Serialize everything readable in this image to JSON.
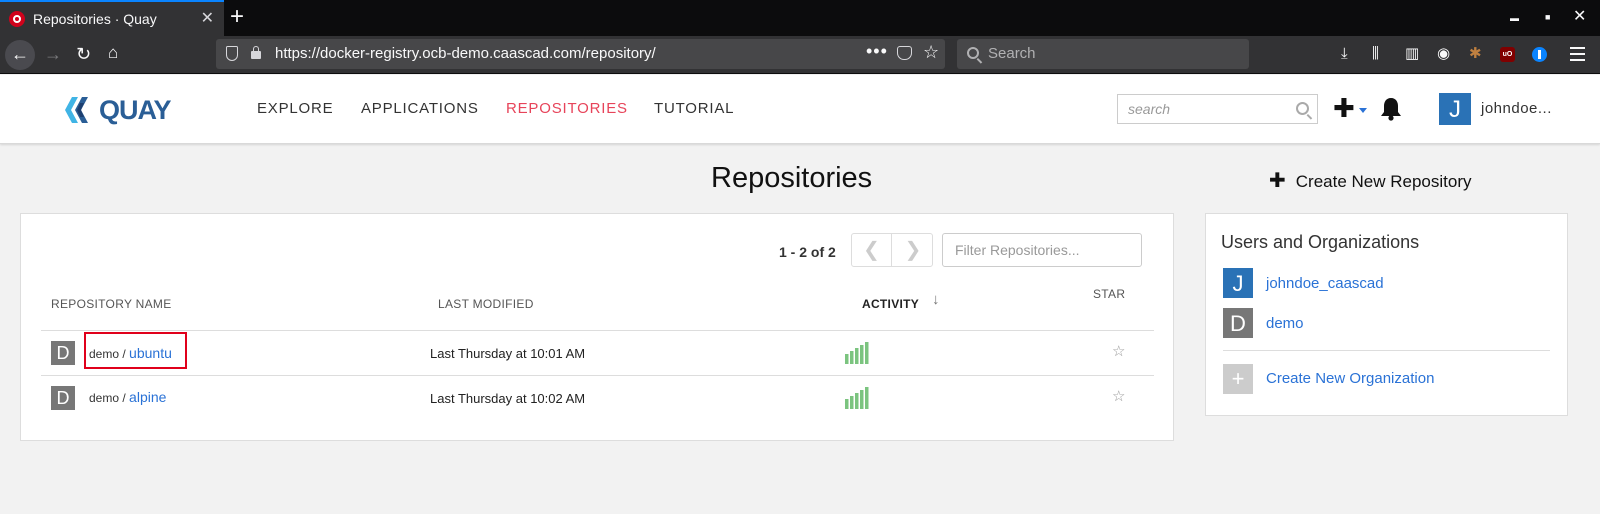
{
  "browser": {
    "tab_title": "Repositories · Quay",
    "tab_close": "✕",
    "new_tab": "+",
    "url": "https://docker-registry.ocb-demo.caascad.com/repository/",
    "search_placeholder": "Search",
    "url_more": "•••",
    "url_star": "☆",
    "win_min": "▬",
    "win_max": "■",
    "win_close": "✕"
  },
  "header": {
    "logo": "QUAY",
    "nav": [
      "EXPLORE",
      "APPLICATIONS",
      "REPOSITORIES",
      "TUTORIAL"
    ],
    "active_nav": "REPOSITORIES",
    "search_placeholder": "search",
    "avatar_letter": "J",
    "username": "johndoe...",
    "plus_label": "✚"
  },
  "page": {
    "title": "Repositories",
    "create_repo": "Create New Repository",
    "create_plus": "✚"
  },
  "list": {
    "pager_count": "1 - 2 of 2",
    "prev": "❮",
    "next": "❯",
    "filter_placeholder": "Filter Repositories...",
    "columns": [
      "REPOSITORY NAME",
      "LAST MODIFIED",
      "ACTIVITY",
      "STAR"
    ],
    "sort_arrow": "↓",
    "rows": [
      {
        "avatar": "D",
        "namespace": "demo",
        "sep": " / ",
        "name": "ubuntu",
        "last_modified": "Last Thursday at 10:01 AM",
        "star": "☆"
      },
      {
        "avatar": "D",
        "namespace": "demo",
        "sep": " / ",
        "name": "alpine",
        "last_modified": "Last Thursday at 10:02 AM",
        "star": "☆"
      }
    ]
  },
  "orgs": {
    "title": "Users and Organizations",
    "items": [
      {
        "avatar": "J",
        "name": "johndoe_caascad",
        "color": "#2a72b6"
      },
      {
        "avatar": "D",
        "name": "demo",
        "color": "#777777"
      }
    ],
    "create_label": "Create New Organization",
    "create_icon": "+"
  },
  "colors": {
    "accent": "#e7445a",
    "link": "#2a72d6",
    "activity": "#7bc47f",
    "highlight": "#e0001b"
  }
}
